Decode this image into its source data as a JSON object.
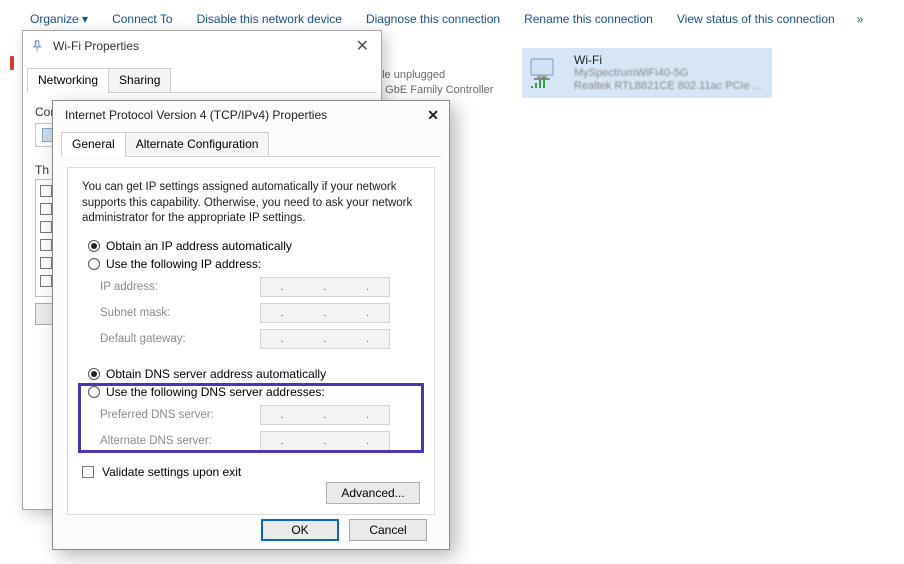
{
  "toolbar": {
    "organize": "Organize ▾",
    "connect": "Connect To",
    "disable": "Disable this network device",
    "diagnose": "Diagnose this connection",
    "rename": "Rename this connection",
    "view_status": "View status of this connection",
    "more": "»"
  },
  "bg": {
    "line1": "ble unplugged",
    "line2": "e GbE Family Controller"
  },
  "adapter": {
    "name": "Wi-Fi",
    "line2": "MySpectrumWiFi40-5G",
    "line3": "Realtek RTL8821CE 802.11ac PCIe ..."
  },
  "wifi_props": {
    "title": "Wi-Fi Properties",
    "tab_networking": "Networking",
    "tab_sharing": "Sharing",
    "connect_using": "Connect using:",
    "this_conn": "Th"
  },
  "ipv4": {
    "title": "Internet Protocol Version 4 (TCP/IPv4) Properties",
    "tab_general": "General",
    "tab_alt": "Alternate Configuration",
    "desc": "You can get IP settings assigned automatically if your network supports this capability. Otherwise, you need to ask your network administrator for the appropriate IP settings.",
    "auto_ip": "Obtain an IP address automatically",
    "use_ip": "Use the following IP address:",
    "ip_addr": "IP address:",
    "subnet": "Subnet mask:",
    "gateway": "Default gateway:",
    "auto_dns": "Obtain DNS server address automatically",
    "use_dns": "Use the following DNS server addresses:",
    "pref_dns": "Preferred DNS server:",
    "alt_dns": "Alternate DNS server:",
    "validate": "Validate settings upon exit",
    "advanced": "Advanced...",
    "ok": "OK",
    "cancel": "Cancel"
  }
}
